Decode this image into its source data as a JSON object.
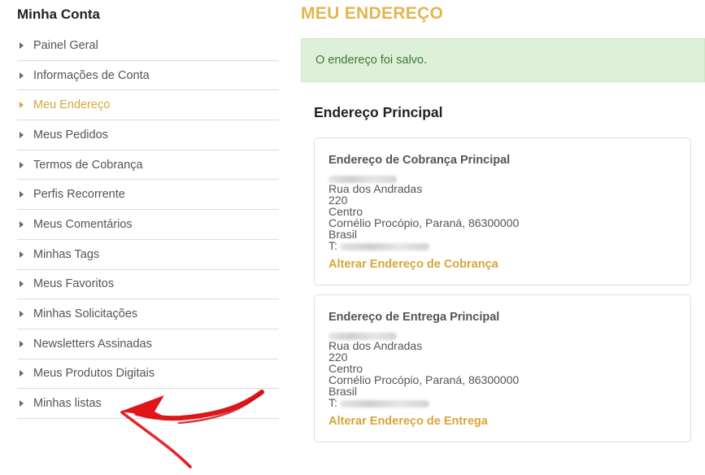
{
  "sidebar": {
    "title": "Minha Conta",
    "items": [
      {
        "label": "Painel Geral",
        "active": false
      },
      {
        "label": "Informações de Conta",
        "active": false
      },
      {
        "label": "Meu Endereço",
        "active": true
      },
      {
        "label": "Meus Pedidos",
        "active": false
      },
      {
        "label": "Termos de Cobrança",
        "active": false
      },
      {
        "label": "Perfis Recorrente",
        "active": false
      },
      {
        "label": "Meus Comentários",
        "active": false
      },
      {
        "label": "Minhas Tags",
        "active": false
      },
      {
        "label": "Meus Favoritos",
        "active": false
      },
      {
        "label": "Minhas Solicitações",
        "active": false
      },
      {
        "label": "Newsletters Assinadas",
        "active": false
      },
      {
        "label": "Meus Produtos Digitais",
        "active": false
      },
      {
        "label": "Minhas listas",
        "active": false
      }
    ]
  },
  "main": {
    "page_title": "MEU ENDEREÇO",
    "alert": "O endereço foi salvo.",
    "section_title": "Endereço Principal",
    "billing": {
      "title": "Endereço de Cobrança Principal",
      "street": "Rua dos Andradas",
      "number": "220",
      "district": "Centro",
      "city_line": "Cornélio Procópio, Paraná, 86300000",
      "country": "Brasil",
      "phone_prefix": "T:",
      "link": "Alterar Endereço de Cobrança"
    },
    "shipping": {
      "title": "Endereço de Entrega Principal",
      "street": "Rua dos Andradas",
      "number": "220",
      "district": "Centro",
      "city_line": "Cornélio Procópio, Paraná, 86300000",
      "country": "Brasil",
      "phone_prefix": "T:",
      "link": "Alterar Endereço de Entrega"
    }
  },
  "colors": {
    "accent": "#e3b54f",
    "link": "#d4a73a",
    "success_bg": "#dff0d8",
    "success_text": "#3c763d",
    "annotation_arrow": "#e0141b"
  },
  "icons": {
    "nav_caret": "caret-right-icon",
    "annotation": "red-arrow-annotation"
  }
}
